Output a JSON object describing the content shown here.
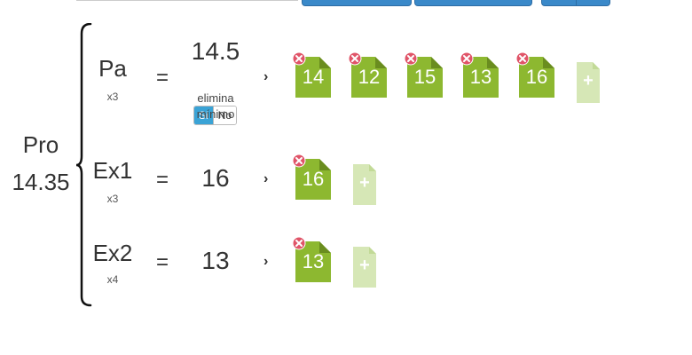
{
  "overall": {
    "name": "Pro",
    "value": "14.35"
  },
  "rows": [
    {
      "name": "Pa",
      "multiplier": "x3",
      "equals": "=",
      "value": "14.5",
      "arrow": "›",
      "grades": [
        "14",
        "12",
        "15",
        "13",
        "16"
      ],
      "toggle": {
        "yes_label": "Si",
        "no_label": "No",
        "selected": "Si"
      },
      "note_line1": "elimina",
      "note_line2": "mínimo"
    },
    {
      "name": "Ex1",
      "multiplier": "x3",
      "equals": "=",
      "value": "16",
      "arrow": "›",
      "grades": [
        "16"
      ]
    },
    {
      "name": "Ex2",
      "multiplier": "x4",
      "equals": "=",
      "value": "13",
      "arrow": "›",
      "grades": [
        "13"
      ]
    }
  ],
  "add_label": "+",
  "colors": {
    "grade_fill": "#8db830",
    "grade_fold": "#6a8d1f",
    "remove_badge": "#e05468",
    "add_fill": "#d6e7b6",
    "toggle_on": "#3aa3d6",
    "top_buttons": "#3a89c9"
  },
  "icons": {
    "grade": "grade-file-icon",
    "remove": "remove-circle-icon",
    "add": "add-file-icon",
    "arrow": "chevron-right-icon"
  }
}
